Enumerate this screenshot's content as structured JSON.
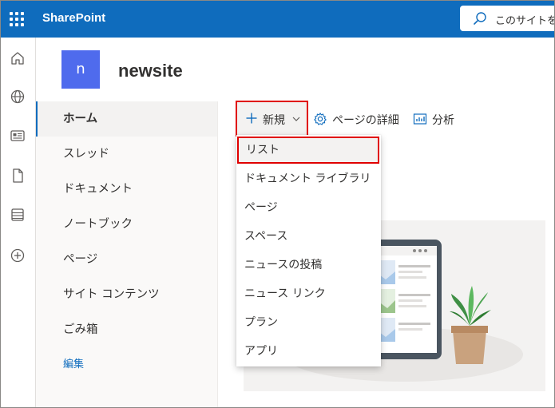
{
  "suitebar": {
    "app_name": "SharePoint",
    "search_placeholder": "このサイトを",
    "background": "#0f6cbd"
  },
  "rail": {
    "icons": [
      "home-icon",
      "globe-icon",
      "news-icon",
      "document-icon",
      "list-icon",
      "add-icon"
    ]
  },
  "site": {
    "logo_letter": "n",
    "title": "newsite",
    "logo_color": "#4f6bed"
  },
  "leftnav": {
    "items": [
      {
        "label": "ホーム",
        "active": true
      },
      {
        "label": "スレッド"
      },
      {
        "label": "ドキュメント"
      },
      {
        "label": "ノートブック"
      },
      {
        "label": "ページ"
      },
      {
        "label": "サイト コンテンツ"
      },
      {
        "label": "ごみ箱"
      }
    ],
    "edit_label": "編集"
  },
  "commandbar": {
    "new_label": "新規",
    "page_details_label": "ページの詳細",
    "analytics_label": "分析"
  },
  "new_menu": {
    "items": [
      {
        "label": "リスト",
        "highlighted": true
      },
      {
        "label": "ドキュメント ライブラリ"
      },
      {
        "label": "ページ"
      },
      {
        "label": "スペース"
      },
      {
        "label": "ニュースの投稿"
      },
      {
        "label": "ニュース リンク"
      },
      {
        "label": "プラン"
      },
      {
        "label": "アプリ"
      }
    ]
  },
  "colors": {
    "accent": "#0f6cbd",
    "highlight_border": "#e00000"
  }
}
